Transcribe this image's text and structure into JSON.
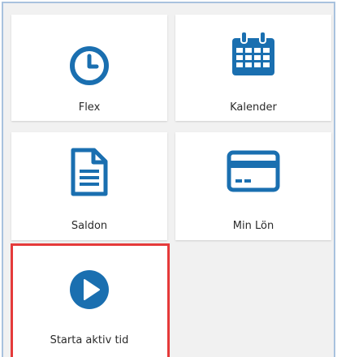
{
  "tiles": {
    "flex": {
      "label": "Flex",
      "icon": "clock-icon"
    },
    "kalender": {
      "label": "Kalender",
      "icon": "calendar-icon"
    },
    "saldon": {
      "label": "Saldon",
      "icon": "document-icon"
    },
    "min_lon": {
      "label": "Min Lön",
      "icon": "credit-card-icon"
    },
    "starta": {
      "label": "Starta aktiv tid",
      "icon": "play-icon"
    }
  },
  "colors": {
    "icon": "#1a6fb0",
    "highlight": "#e53a3a",
    "frame": "#a8c2de"
  }
}
